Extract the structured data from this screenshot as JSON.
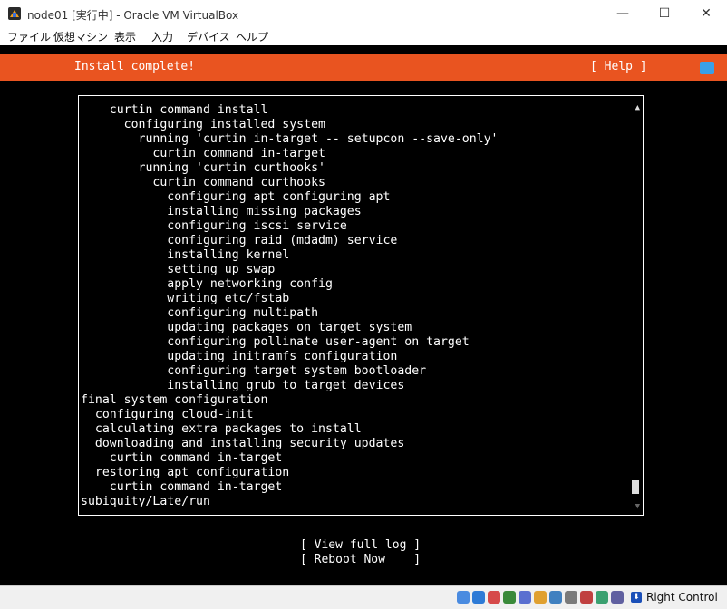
{
  "window": {
    "title": "node01 [実行中] - Oracle VM VirtualBox",
    "controls": {
      "minimize": "—",
      "maximize": "☐",
      "close": "✕"
    }
  },
  "menu": [
    "ファイル",
    "仮想マシン",
    "表示",
    "入力",
    "デバイス",
    "ヘルプ"
  ],
  "installer": {
    "header_title": "Install complete!",
    "help_label": "[ Help ]",
    "log_lines": [
      "    curtin command install",
      "      configuring installed system",
      "        running 'curtin in-target -- setupcon --save-only'",
      "          curtin command in-target",
      "        running 'curtin curthooks'",
      "          curtin command curthooks",
      "            configuring apt configuring apt",
      "            installing missing packages",
      "            configuring iscsi service",
      "            configuring raid (mdadm) service",
      "            installing kernel",
      "            setting up swap",
      "            apply networking config",
      "            writing etc/fstab",
      "            configuring multipath",
      "            updating packages on target system",
      "            configuring pollinate user-agent on target",
      "            updating initramfs configuration",
      "            configuring target system bootloader",
      "            installing grub to target devices",
      "final system configuration",
      "  configuring cloud-init",
      "  calculating extra packages to install",
      "  downloading and installing security updates",
      "    curtin command in-target",
      "  restoring apt configuration",
      "    curtin command in-target",
      "subiquity/Late/run"
    ],
    "scroll_up": "▲",
    "scroll_down": "▼",
    "buttons": {
      "view_full_log": "[ View full log ]",
      "reboot_now": "[ Reboot Now    ]"
    }
  },
  "statusbar": {
    "host_key_label": "Right Control",
    "icons": [
      "hard-disk-icon",
      "optical-drive-icon",
      "audio-icon",
      "network-icon",
      "usb-icon",
      "shared-folder-icon",
      "display-icon",
      "video-capture-icon",
      "recording-icon",
      "guest-additions-icon",
      "mouse-integration-icon"
    ]
  }
}
